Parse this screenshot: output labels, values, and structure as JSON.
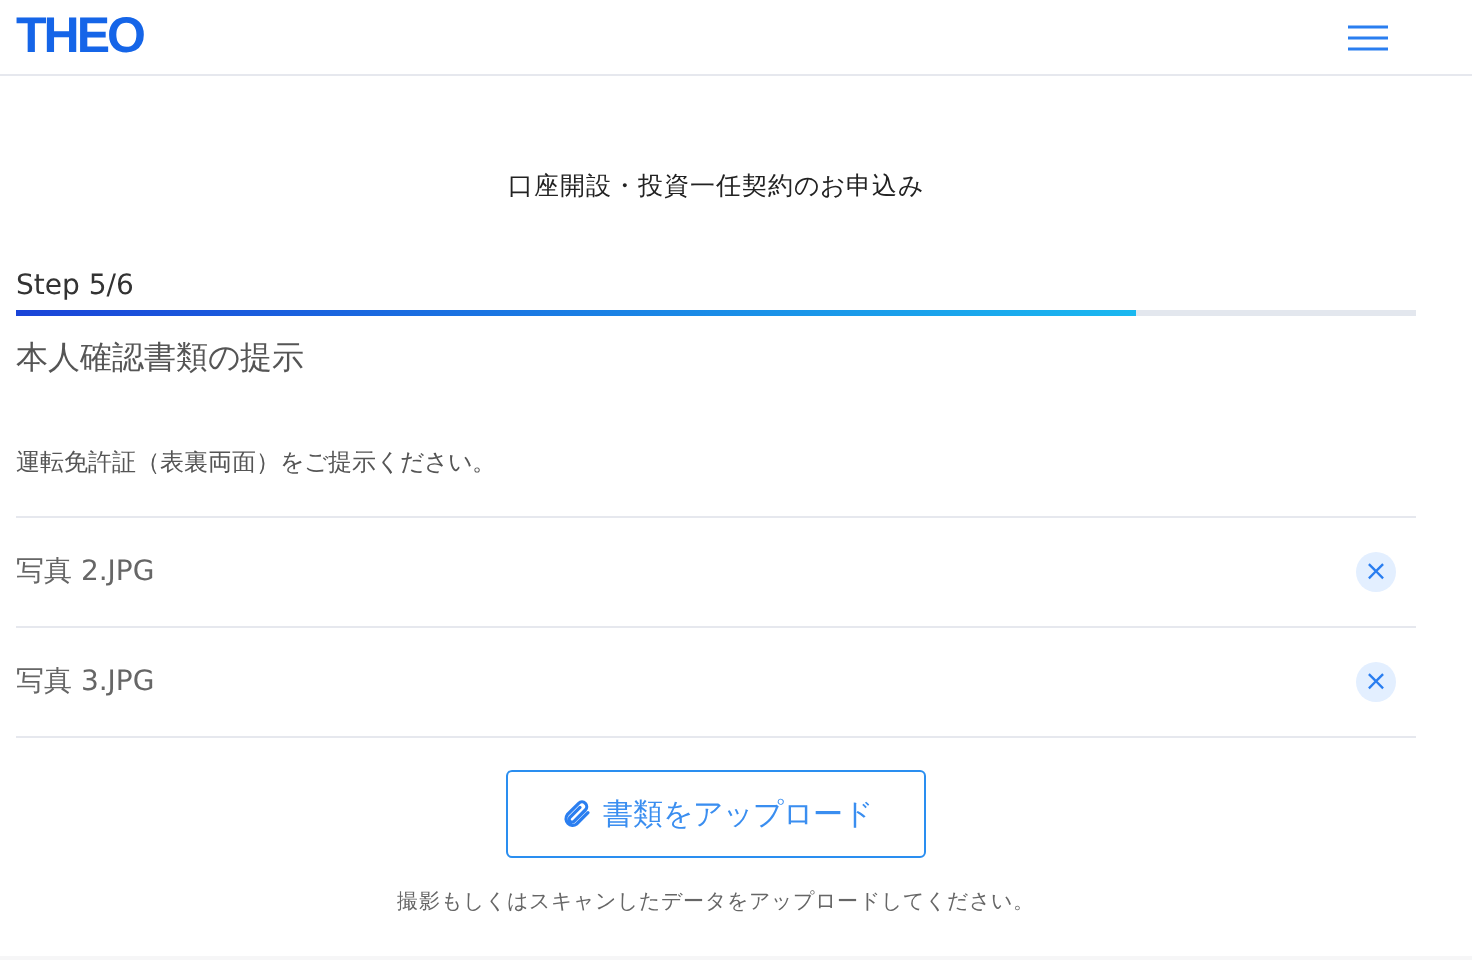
{
  "header": {
    "logo": "THEO"
  },
  "page_title": "口座開設・投資一任契約のお申込み",
  "progress": {
    "label": "Step 5/6",
    "level": 0.8
  },
  "section_title": "本人確認書類の提示",
  "instruction": "運転免許証（表裏両面）をご提示ください。",
  "files": [
    {
      "name": "写真 2.JPG",
      "remove": "×"
    },
    {
      "name": "写真 3.JPG",
      "remove": "×"
    }
  ],
  "upload_button": "書類をアップロード",
  "note": "撮影もしくはスキャンしたデータをアップロードしてください。"
}
